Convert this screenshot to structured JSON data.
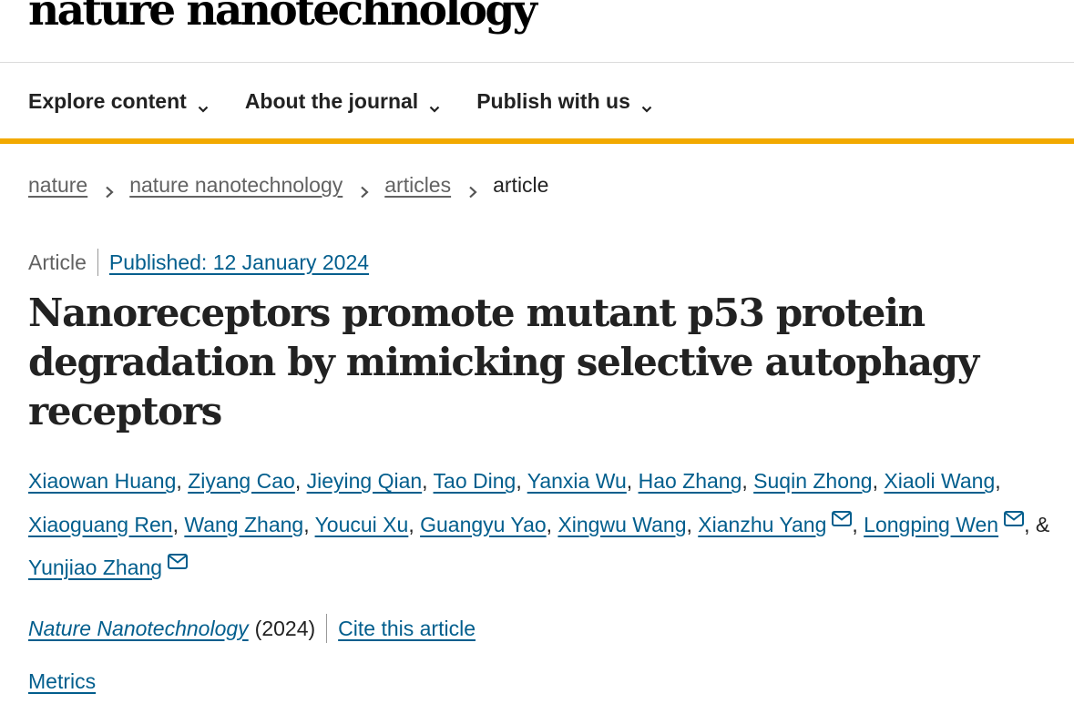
{
  "header": {
    "masthead": "nature nanotechnology"
  },
  "nav": {
    "items": [
      {
        "label": "Explore content",
        "icon": "chevron-down-icon"
      },
      {
        "label": "About the journal",
        "icon": "chevron-down-icon"
      },
      {
        "label": "Publish with us",
        "icon": "chevron-down-icon"
      }
    ]
  },
  "breadcrumb": {
    "items": [
      "nature",
      "nature nanotechnology",
      "articles"
    ],
    "current": "article",
    "separator_icon": "chevron-right-icon"
  },
  "article": {
    "type": "Article",
    "published": "Published: 12 January 2024",
    "title": "Nanoreceptors promote mutant p53 protein degradation by mimicking selective autophagy receptors",
    "authors": [
      {
        "name": "Xiaowan Huang"
      },
      {
        "name": "Ziyang Cao"
      },
      {
        "name": "Jieying Qian"
      },
      {
        "name": "Tao Ding"
      },
      {
        "name": "Yanxia Wu"
      },
      {
        "name": "Hao Zhang"
      },
      {
        "name": "Suqin Zhong"
      },
      {
        "name": "Xiaoli Wang"
      },
      {
        "name": "Xiaoguang Ren"
      },
      {
        "name": "Wang Zhang"
      },
      {
        "name": "Youcui Xu"
      },
      {
        "name": "Guangyu Yao"
      },
      {
        "name": "Xingwu Wang"
      },
      {
        "name": "Xianzhu Yang",
        "corresponding": true
      },
      {
        "name": "Longping Wen",
        "corresponding": true
      },
      {
        "name": "Yunjiao Zhang",
        "corresponding": true
      }
    ],
    "author_separator": ", ",
    "last_author_joiner": "& ",
    "journal": "Nature Nanotechnology",
    "year": "(2024)",
    "cite_label": "Cite this article",
    "metrics_label": "Metrics"
  },
  "colors": {
    "link": "#025e8d",
    "accent_bar": "#f2a900",
    "text": "#222222",
    "muted": "#626262"
  }
}
